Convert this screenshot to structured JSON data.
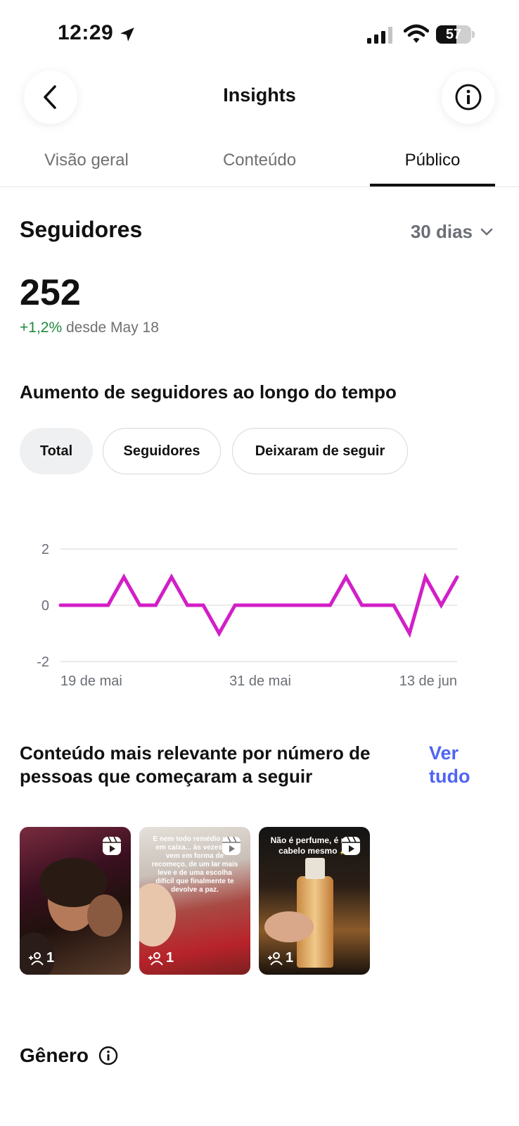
{
  "status_bar": {
    "time": "12:29",
    "battery_percent": "57",
    "battery_level": 0.57
  },
  "header": {
    "title": "Insights"
  },
  "tabs": [
    {
      "label": "Visão geral",
      "active": false
    },
    {
      "label": "Conteúdo",
      "active": false
    },
    {
      "label": "Público",
      "active": true
    }
  ],
  "followers": {
    "title": "Seguidores",
    "period": "30 dias",
    "count": "252",
    "change_pct": "+1,2%",
    "change_text": "desde May 18"
  },
  "growth_chart": {
    "title": "Aumento de seguidores ao longo do tempo",
    "filters": [
      {
        "label": "Total",
        "active": true
      },
      {
        "label": "Seguidores",
        "active": false
      },
      {
        "label": "Deixaram de seguir",
        "active": false
      }
    ]
  },
  "chart_data": {
    "type": "line",
    "title": "",
    "xlabel": "",
    "ylabel": "",
    "ylim": [
      -2,
      2
    ],
    "yticks": [
      "2",
      "0",
      "-2"
    ],
    "xticks": [
      "19 de mai",
      "31 de mai",
      "13 de jun"
    ],
    "grid": true,
    "color": "#d21fc7",
    "values": [
      0,
      0,
      0,
      0,
      1,
      0,
      0,
      1,
      0,
      0,
      -1,
      0,
      0,
      0,
      0,
      0,
      0,
      0,
      1,
      0,
      0,
      0,
      -1,
      1,
      0,
      1
    ]
  },
  "top_content": {
    "title": "Conteúdo mais relevante por número de pessoas que começaram a seguir",
    "see_all": "Ver tudo",
    "items": [
      {
        "count": "1",
        "caption": ""
      },
      {
        "count": "1",
        "caption": "E nem todo remédio vem em caixa... às vezes ele vem em forma de recomeço, de um lar mais leve e de uma escolha difícil que finalmente te devolve a paz."
      },
      {
        "count": "1",
        "caption": "Não é perfume, é meu cabelo mesmo ✨"
      }
    ]
  },
  "gender": {
    "title": "Gênero"
  }
}
